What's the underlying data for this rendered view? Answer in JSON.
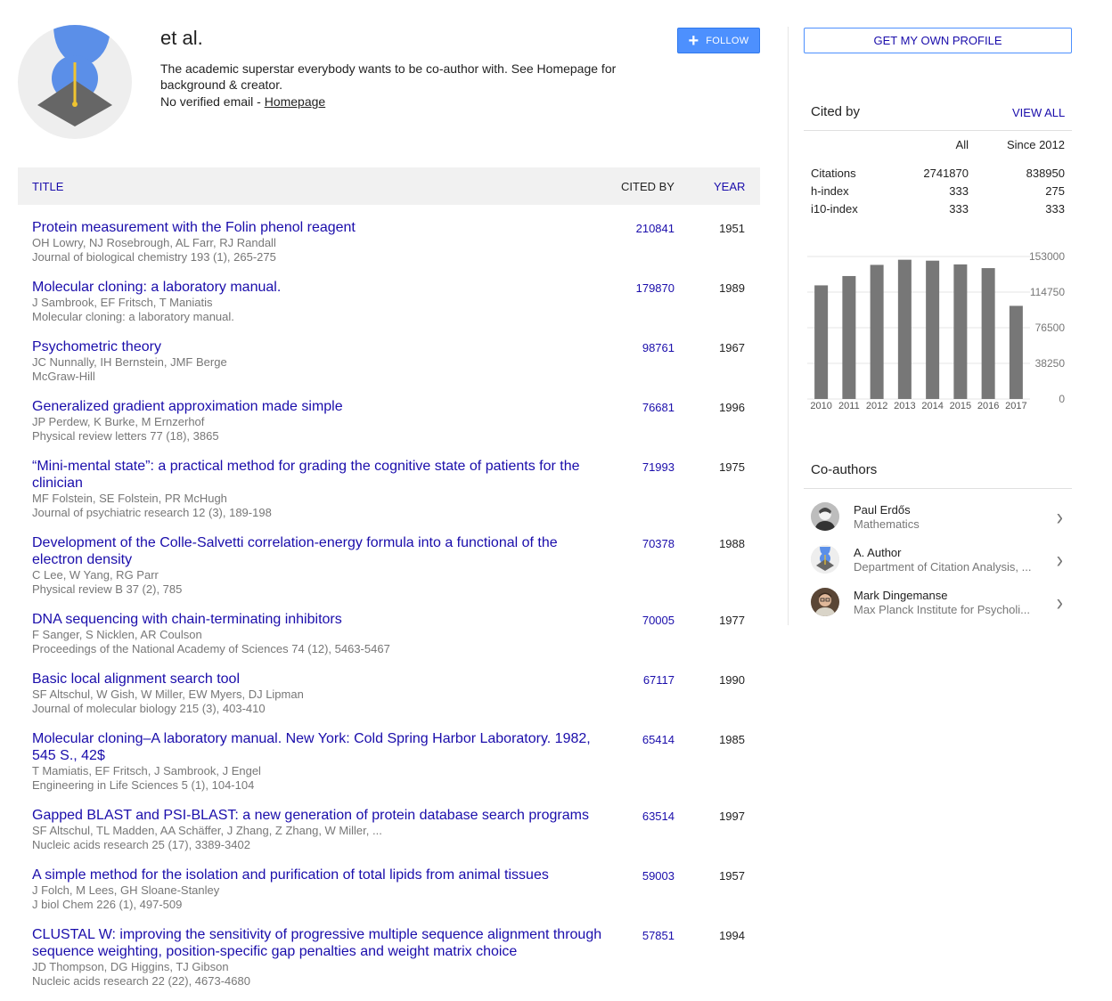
{
  "profile": {
    "name": "et al.",
    "tagline": "The academic superstar everybody wants to be co-author with. See Homepage for background & creator.",
    "email_text": "No verified email - ",
    "homepage_label": "Homepage",
    "follow_label": "FOLLOW",
    "follow_icon": "plus-icon"
  },
  "table": {
    "headers": {
      "title": "TITLE",
      "cited_by": "CITED BY",
      "year": "YEAR"
    },
    "rows": [
      {
        "title": "Protein measurement with the Folin phenol reagent",
        "authors": "OH Lowry, NJ Rosebrough, AL Farr, RJ Randall",
        "venue": "Journal of biological chemistry 193 (1), 265-275",
        "cited_by": "210841",
        "year": "1951"
      },
      {
        "title": "Molecular cloning: a laboratory manual.",
        "authors": "J Sambrook, EF Fritsch, T Maniatis",
        "venue": "Molecular cloning: a laboratory manual.",
        "cited_by": "179870",
        "year": "1989"
      },
      {
        "title": "Psychometric theory",
        "authors": "JC Nunnally, IH Bernstein, JMF Berge",
        "venue": "McGraw-Hill",
        "cited_by": "98761",
        "year": "1967"
      },
      {
        "title": "Generalized gradient approximation made simple",
        "authors": "JP Perdew, K Burke, M Ernzerhof",
        "venue": "Physical review letters 77 (18), 3865",
        "cited_by": "76681",
        "year": "1996"
      },
      {
        "title": "“Mini-mental state”: a practical method for grading the cognitive state of patients for the clinician",
        "authors": "MF Folstein, SE Folstein, PR McHugh",
        "venue": "Journal of psychiatric research 12 (3), 189-198",
        "cited_by": "71993",
        "year": "1975"
      },
      {
        "title": "Development of the Colle-Salvetti correlation-energy formula into a functional of the electron density",
        "authors": "C Lee, W Yang, RG Parr",
        "venue": "Physical review B 37 (2), 785",
        "cited_by": "70378",
        "year": "1988"
      },
      {
        "title": "DNA sequencing with chain-terminating inhibitors",
        "authors": "F Sanger, S Nicklen, AR Coulson",
        "venue": "Proceedings of the National Academy of Sciences 74 (12), 5463-5467",
        "cited_by": "70005",
        "year": "1977"
      },
      {
        "title": "Basic local alignment search tool",
        "authors": "SF Altschul, W Gish, W Miller, EW Myers, DJ Lipman",
        "venue": "Journal of molecular biology 215 (3), 403-410",
        "cited_by": "67117",
        "year": "1990"
      },
      {
        "title": "Molecular cloning–A laboratory manual. New York: Cold Spring Harbor Laboratory. 1982, 545 S., 42$",
        "authors": "T Mamiatis, EF Fritsch, J Sambrook, J Engel",
        "venue": "Engineering in Life Sciences 5 (1), 104-104",
        "cited_by": "65414",
        "year": "1985"
      },
      {
        "title": "Gapped BLAST and PSI-BLAST: a new generation of protein database search programs",
        "authors": "SF Altschul, TL Madden, AA Schäffer, J Zhang, Z Zhang, W Miller, ...",
        "venue": "Nucleic acids research 25 (17), 3389-3402",
        "cited_by": "63514",
        "year": "1997"
      },
      {
        "title": "A simple method for the isolation and purification of total lipids from animal tissues",
        "authors": "J Folch, M Lees, GH Sloane-Stanley",
        "venue": "J biol Chem 226 (1), 497-509",
        "cited_by": "59003",
        "year": "1957"
      },
      {
        "title": "CLUSTAL W: improving the sensitivity of progressive multiple sequence alignment through sequence weighting, position-specific gap penalties and weight matrix choice",
        "authors": "JD Thompson, DG Higgins, TJ Gibson",
        "venue": "Nucleic acids research 22 (22), 4673-4680",
        "cited_by": "57851",
        "year": "1994"
      }
    ]
  },
  "sidebar": {
    "own_profile_label": "GET MY OWN PROFILE",
    "cited_by_title": "Cited by",
    "view_all_label": "VIEW ALL",
    "stats": {
      "headers": [
        "",
        "All",
        "Since 2012"
      ],
      "rows": [
        [
          "Citations",
          "2741870",
          "838950"
        ],
        [
          "h-index",
          "333",
          "275"
        ],
        [
          "i10-index",
          "333",
          "333"
        ]
      ]
    },
    "coauthors_title": "Co-authors",
    "coauthors": [
      {
        "name": "Paul Erdős",
        "affiliation": "Mathematics",
        "icon": "chevron-right-icon"
      },
      {
        "name": "A. Author",
        "affiliation": "Department of Citation Analysis, ...",
        "icon": "chevron-right-icon"
      },
      {
        "name": "Mark Dingemanse",
        "affiliation": "Max Planck Institute for Psycholi...",
        "icon": "chevron-right-icon"
      }
    ]
  },
  "colors": {
    "link": "#1a0dab",
    "bar": "#777777",
    "follow_button": "#4d90fe",
    "header_bg": "#f1f1f1"
  },
  "chart_data": {
    "type": "bar",
    "categories": [
      "2010",
      "2011",
      "2012",
      "2013",
      "2014",
      "2015",
      "2016",
      "2017"
    ],
    "values": [
      122000,
      132000,
      144000,
      149500,
      148500,
      144500,
      140500,
      100000
    ],
    "yticks": [
      "0",
      "38250",
      "76500",
      "114750",
      "153000"
    ],
    "ylim": [
      0,
      153000
    ],
    "title": "",
    "xlabel": "",
    "ylabel": ""
  }
}
